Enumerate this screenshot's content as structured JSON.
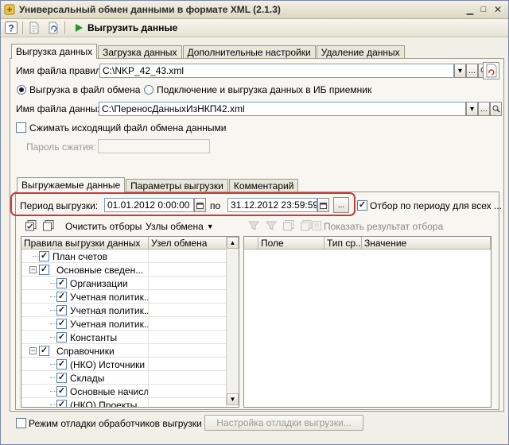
{
  "window": {
    "title": "Универсальный обмен данными в формате XML (2.1.3)"
  },
  "toolbar": {
    "run_label": "Выгрузить данные"
  },
  "main_tabs": [
    {
      "label": "Выгрузка данных",
      "active": true
    },
    {
      "label": "Загрузка данных",
      "active": false
    },
    {
      "label": "Дополнительные настройки",
      "active": false
    },
    {
      "label": "Удаление данных",
      "active": false
    }
  ],
  "rules_file": {
    "label": "Имя файла правил:",
    "value": "C:\\NKP_42_43.xml"
  },
  "export_mode": {
    "option_file": "Выгрузка в файл обмена",
    "option_ib": "Подключение и выгрузка данных в ИБ приемник",
    "selected": "file"
  },
  "data_file": {
    "label": "Имя файла данных:",
    "value": "C:\\ПереносДанныхИзНКП42.xml"
  },
  "compress": {
    "label": "Сжимать исходящий файл обмена данными",
    "checked": false,
    "password_label": "Пароль сжатия:",
    "password_value": ""
  },
  "inner_tabs": [
    {
      "label": "Выгружаемые данные",
      "active": true
    },
    {
      "label": "Параметры выгрузки",
      "active": false
    },
    {
      "label": "Комментарий",
      "active": false
    }
  ],
  "period": {
    "label": "Период выгрузки:",
    "from": "01.01.2012  0:00:00",
    "separator": "по",
    "to": "31.12.2012 23:59:59",
    "more_button": "...",
    "filter_label": "Отбор по периоду для всех ...",
    "filter_checked": true
  },
  "rules_toolbar": {
    "clear_filters": "Очистить отборы",
    "nodes_menu": "Узлы обмена",
    "show_filter_result": "Показать результат отбора"
  },
  "rules_grid": {
    "columns": [
      "Правила выгрузки данных",
      "Узел обмена"
    ],
    "rows": [
      {
        "label": "План счетов",
        "level": 0,
        "expander": "",
        "checked": true,
        "bold": false
      },
      {
        "label": "Основные сведен...",
        "level": 0,
        "expander": "-",
        "checked": true,
        "bold": false
      },
      {
        "label": "Организации",
        "level": 1,
        "expander": "",
        "checked": true,
        "bold": false
      },
      {
        "label": "Учетная политик...",
        "level": 1,
        "expander": "",
        "checked": true,
        "bold": false
      },
      {
        "label": "Учетная политик...",
        "level": 1,
        "expander": "",
        "checked": true,
        "bold": false
      },
      {
        "label": "Учетная политик...",
        "level": 1,
        "expander": "",
        "checked": true,
        "bold": false
      },
      {
        "label": "Константы",
        "level": 1,
        "expander": "",
        "checked": true,
        "bold": false
      },
      {
        "label": "Справочники",
        "level": 0,
        "expander": "-",
        "checked": true,
        "bold": false
      },
      {
        "label": "(НКО) Источники",
        "level": 1,
        "expander": "",
        "checked": true,
        "bold": false
      },
      {
        "label": "Склады",
        "level": 1,
        "expander": "",
        "checked": true,
        "bold": false
      },
      {
        "label": "Основные начисл...",
        "level": 1,
        "expander": "",
        "checked": true,
        "bold": false
      },
      {
        "label": "(НКО) Проекты",
        "level": 1,
        "expander": "",
        "checked": true,
        "bold": false
      }
    ]
  },
  "filter_grid": {
    "columns": [
      "Поле",
      "Тип ср...",
      "Значение"
    ]
  },
  "debug": {
    "label": "Режим отладки обработчиков выгрузки",
    "checked": false,
    "settings_button": "Настройка отладки выгрузки..."
  },
  "colors": {
    "highlight": "#d0373a",
    "border": "#9a9a8a",
    "background": "#f1efe6"
  }
}
